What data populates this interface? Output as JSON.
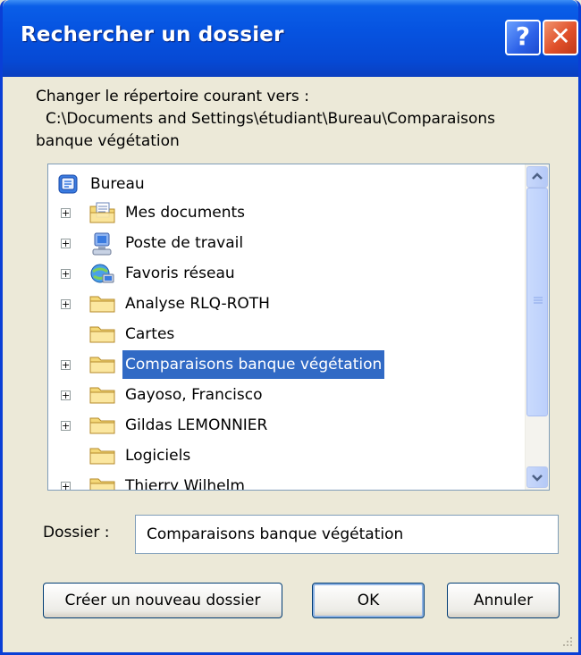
{
  "window": {
    "title": "Rechercher un dossier",
    "help_label": "?",
    "close_label": "✕"
  },
  "prompt": {
    "line1": "Changer le répertoire courant vers :",
    "line2": "C:\\Documents and Settings\\étudiant\\Bureau\\Comparaisons",
    "line3": "banque végétation"
  },
  "tree": {
    "root": "Bureau",
    "items": [
      {
        "label": "Mes documents",
        "icon": "my-documents-icon",
        "expander": "+"
      },
      {
        "label": "Poste de travail",
        "icon": "my-computer-icon",
        "expander": "+"
      },
      {
        "label": "Favoris réseau",
        "icon": "network-places-icon",
        "expander": "+"
      },
      {
        "label": "Analyse RLQ-ROTH",
        "icon": "folder-icon",
        "expander": "+"
      },
      {
        "label": "Cartes",
        "icon": "folder-icon",
        "expander": ""
      },
      {
        "label": "Comparaisons banque végétation",
        "icon": "folder-icon",
        "expander": "+",
        "selected": true
      },
      {
        "label": "Gayoso, Francisco",
        "icon": "folder-icon",
        "expander": "+"
      },
      {
        "label": "Gildas LEMONNIER",
        "icon": "folder-icon",
        "expander": "+"
      },
      {
        "label": "Logiciels",
        "icon": "folder-icon",
        "expander": ""
      },
      {
        "label": "Thierry Wilhelm",
        "icon": "folder-icon",
        "expander": "+"
      }
    ]
  },
  "folder_field": {
    "label": "Dossier :",
    "value": "Comparaisons banque végétation"
  },
  "buttons": {
    "new_folder": "Créer un nouveau dossier",
    "ok": "OK",
    "cancel": "Annuler"
  },
  "colors": {
    "title_blue": "#0653e0",
    "selection": "#316ac5",
    "dialog_bg": "#ece9d8",
    "folder_yellow": "#f4d878"
  }
}
